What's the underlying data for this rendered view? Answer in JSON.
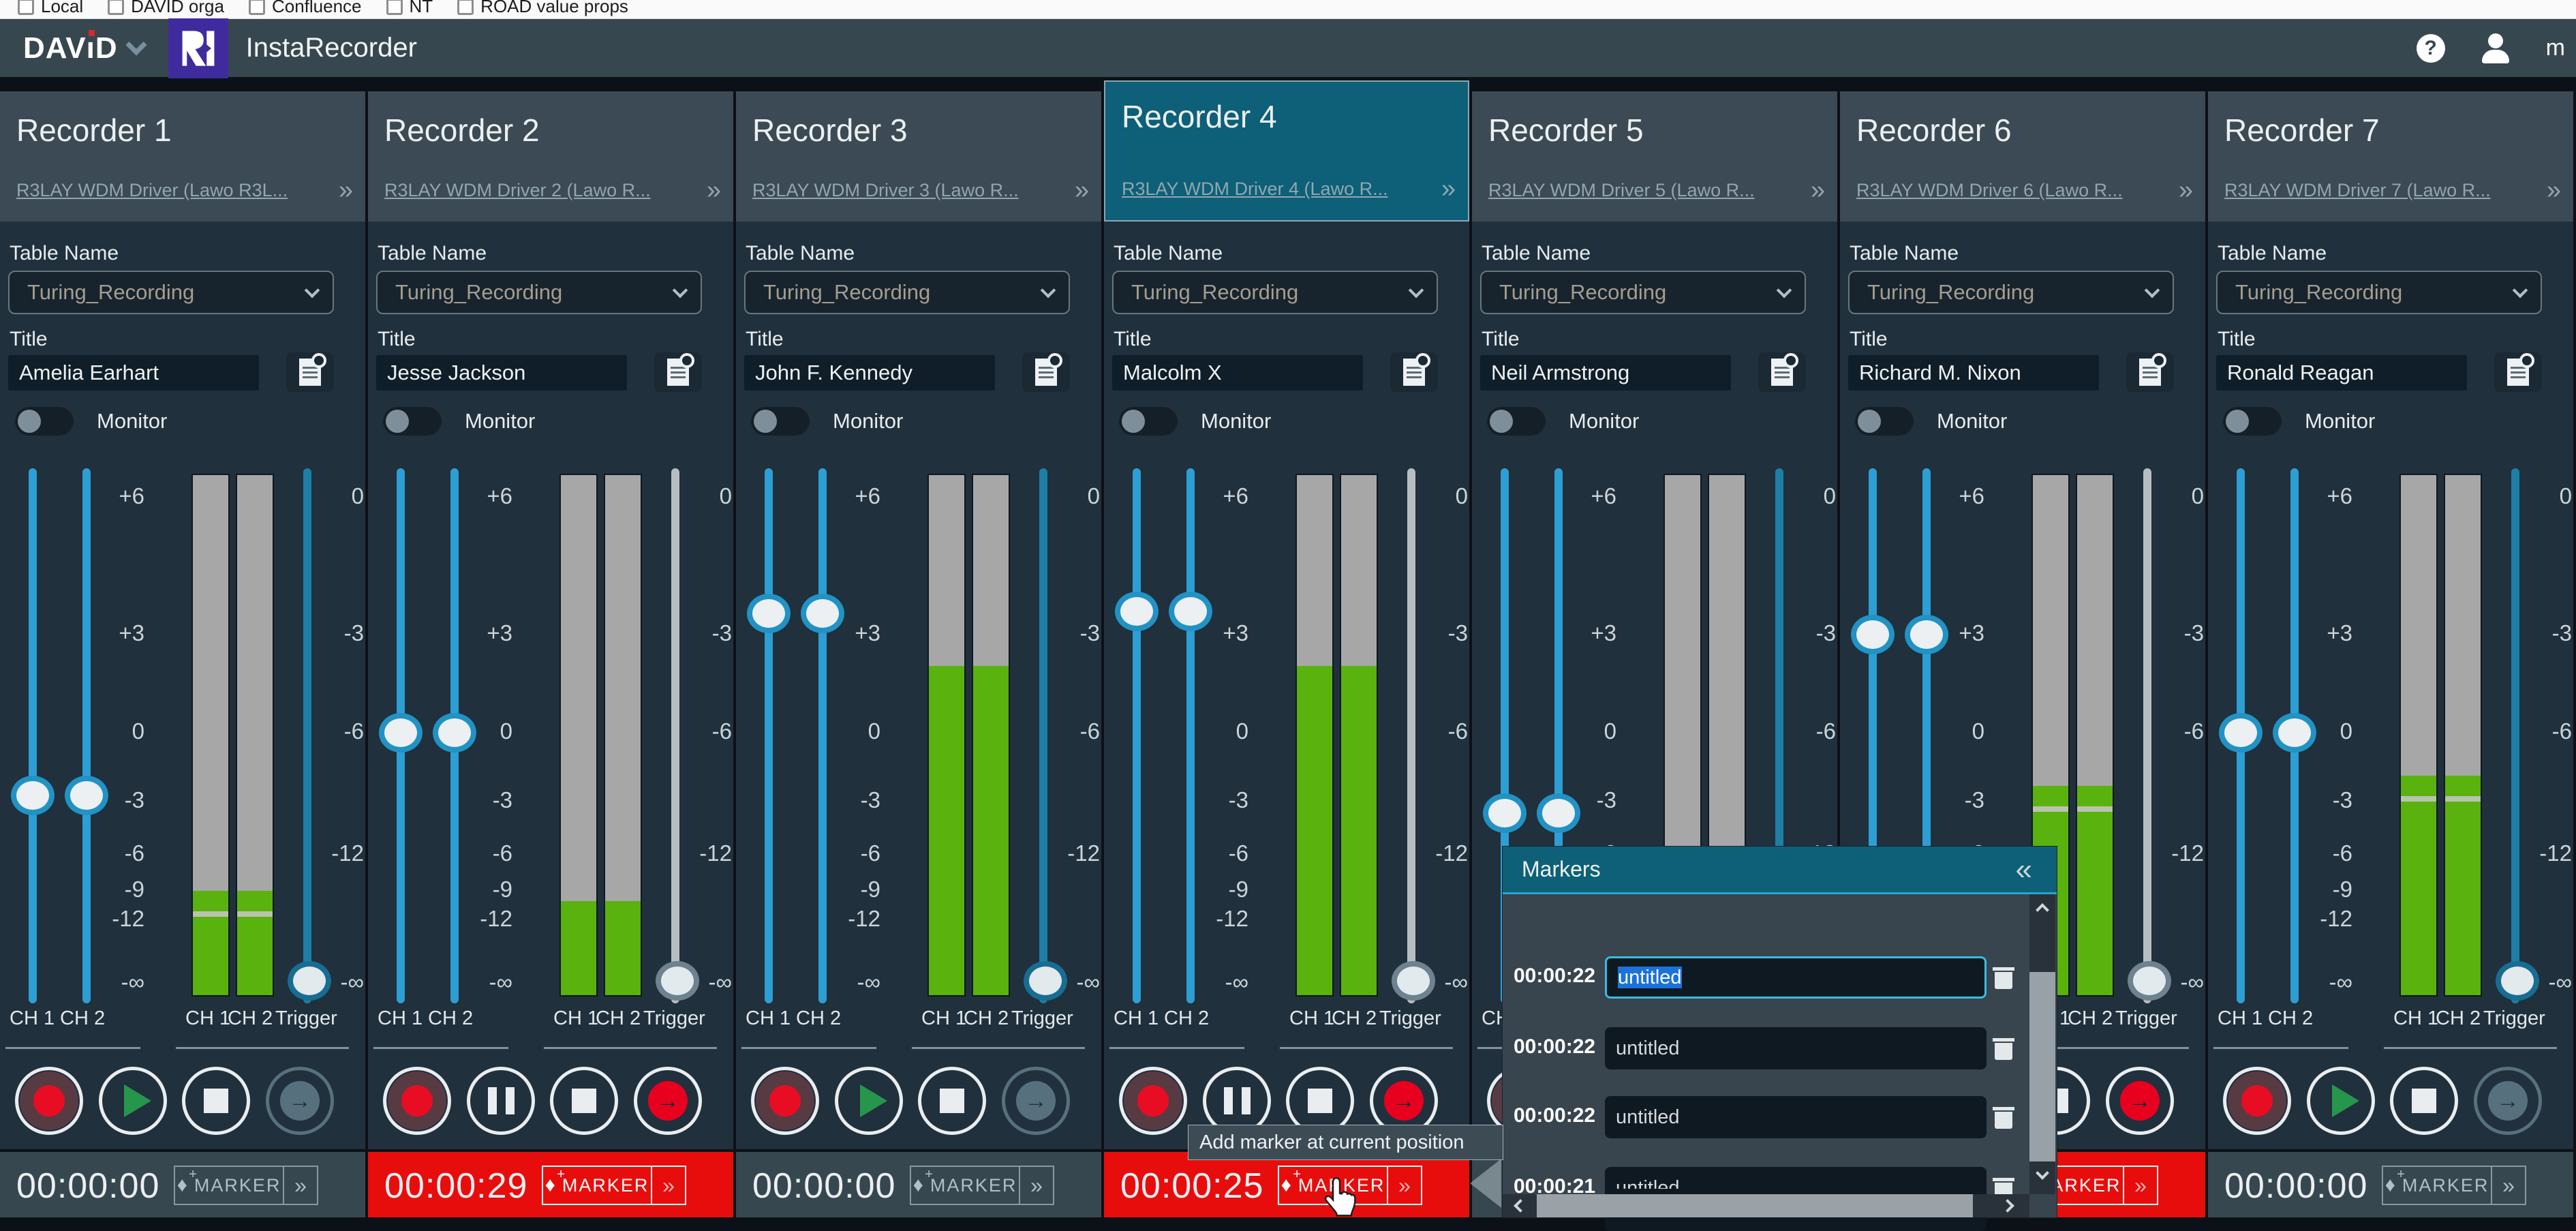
{
  "browser": {
    "bookmarks": [
      "Local",
      "DAVID orga",
      "Confluence",
      "NT",
      "ROAD value props"
    ]
  },
  "app_header": {
    "brand": "DAViD",
    "product": "InstaRecorder",
    "user_label": "m"
  },
  "labels": {
    "table_name": "Table Name",
    "title": "Title",
    "monitor": "Monitor",
    "marker": "MARKER",
    "expand": "»",
    "collapse": "«",
    "ch1": "CH 1",
    "ch2": "CH 2",
    "trigger": "Trigger"
  },
  "scale": {
    "left": [
      "+6",
      "+3",
      "0",
      "-3",
      "-6",
      "-9",
      "-12",
      "-∞"
    ],
    "right": [
      "0",
      "-3",
      "-6",
      "-12",
      "-∞"
    ]
  },
  "recorders": [
    {
      "name": "Recorder 1",
      "driver": "R3LAY WDM Driver (Lawo R3L...",
      "table": "Turing_Recording",
      "title": "Amelia Earhart",
      "timecode": "00:00:00",
      "recording": false,
      "selected": false,
      "fader_db": -3,
      "fader_pos": 0.611,
      "meter_level": 0.2,
      "trigger_pos": 0.958,
      "trigger_enabled": true,
      "peak_strip": true
    },
    {
      "name": "Recorder 2",
      "driver": "R3LAY WDM Driver 2 (Lawo R...",
      "table": "Turing_Recording",
      "title": "Jesse Jackson",
      "timecode": "00:00:29",
      "recording": true,
      "selected": false,
      "fader_db": 0,
      "fader_pos": 0.494,
      "meter_level": 0.18,
      "trigger_pos": 0.958,
      "trigger_enabled": false,
      "peak_strip": false
    },
    {
      "name": "Recorder 3",
      "driver": "R3LAY WDM Driver 3 (Lawo R...",
      "table": "Turing_Recording",
      "title": "John F. Kennedy",
      "timecode": "00:00:00",
      "recording": false,
      "selected": false,
      "fader_db": 3.5,
      "fader_pos": 0.271,
      "meter_level": 0.63,
      "trigger_pos": 0.958,
      "trigger_enabled": true,
      "peak_strip": false
    },
    {
      "name": "Recorder 4",
      "driver": "R3LAY WDM Driver 4 (Lawo R...",
      "table": "Turing_Recording",
      "title": "Malcolm X",
      "timecode": "00:00:25",
      "recording": true,
      "selected": true,
      "fader_db": 3.8,
      "fader_pos": 0.268,
      "meter_level": 0.63,
      "trigger_pos": 0.958,
      "trigger_enabled": false,
      "peak_strip": false
    },
    {
      "name": "Recorder 5",
      "driver": "R3LAY WDM Driver 5 (Lawo R...",
      "table": "Turing_Recording",
      "title": "Neil Armstrong",
      "timecode": "",
      "recording": false,
      "selected": false,
      "fader_db": -3.5,
      "fader_pos": 0.645,
      "meter_level": 0.0,
      "trigger_pos": null,
      "trigger_enabled": true,
      "peak_strip": false
    },
    {
      "name": "Recorder 6",
      "driver": "R3LAY WDM Driver 6 (Lawo R...",
      "table": "Turing_Recording",
      "title": "Richard M. Nixon",
      "timecode": "",
      "recording": true,
      "selected": false,
      "fader_db": 3,
      "fader_pos": 0.311,
      "meter_level": 0.4,
      "trigger_pos": 0.958,
      "trigger_enabled": false,
      "peak_strip": true
    },
    {
      "name": "Recorder 7",
      "driver": "R3LAY WDM Driver 7 (Lawo R...",
      "table": "Turing_Recording",
      "title": "Ronald Reagan",
      "timecode": "00:00:00",
      "recording": false,
      "selected": false,
      "fader_db": 0,
      "fader_pos": 0.494,
      "meter_level": 0.42,
      "trigger_pos": 0.958,
      "trigger_enabled": true,
      "peak_strip": true
    }
  ],
  "markers_panel": {
    "title": "Markers",
    "rows": [
      {
        "time": "00:00:22",
        "name": "untitled",
        "focused": true
      },
      {
        "time": "00:00:22",
        "name": "untitled",
        "focused": false
      },
      {
        "time": "00:00:22",
        "name": "untitled",
        "focused": false
      },
      {
        "time": "00:00:21",
        "name": "untitled",
        "focused": false
      },
      {
        "time": "",
        "name": "",
        "focused": false
      }
    ]
  },
  "tooltip": {
    "text": "Add marker at current position"
  },
  "colors": {
    "appbar": "#37474f",
    "selected_teal": "#0d6078",
    "record_red": "#e80d0d",
    "fader_blue": "#2e9fd4",
    "meter_green": "#5ab20e",
    "logo_purple": "#3f2b9d",
    "column_bg": "#20303d",
    "panel_bg": "#38444e"
  }
}
